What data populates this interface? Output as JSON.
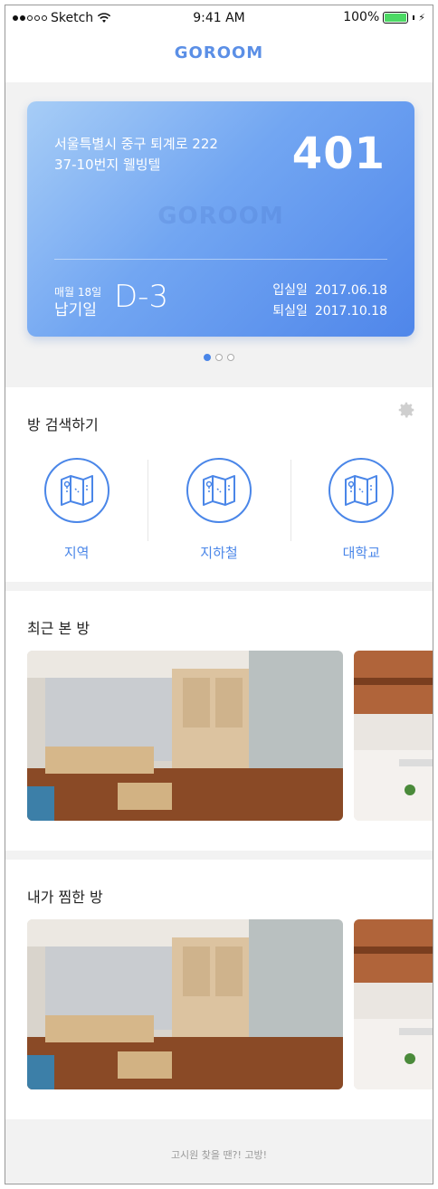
{
  "status_bar": {
    "carrier": "Sketch",
    "time": "9:41 AM",
    "battery": "100%",
    "battery_level": 1.0
  },
  "nav": {
    "title": "GOROOM"
  },
  "room_card": {
    "address_line1": "서울특별시 중구 퇴계로 222",
    "address_line2": "37-10번지 웰빙텔",
    "room_number": "401",
    "watermark": "GOROOM",
    "due_day": "매월 18일",
    "due_label": "납기일",
    "due_countdown": "D-3",
    "move_in_label": "입실일",
    "move_in_date": "2017.06.18",
    "move_out_label": "퇴실일",
    "move_out_date": "2017.10.18",
    "pager_count": 3,
    "pager_active": 1
  },
  "search": {
    "title": "방 검색하기",
    "options": [
      {
        "label": "지역",
        "icon": "map-icon"
      },
      {
        "label": "지하철",
        "icon": "map-icon"
      },
      {
        "label": "대학교",
        "icon": "map-icon"
      }
    ],
    "settings_icon": "gear-icon"
  },
  "recent": {
    "title": "최근 본 방"
  },
  "liked": {
    "title": "내가 찜한 방"
  },
  "footer": {
    "text": "고시원 찾을 땐?! 고방!"
  },
  "colors": {
    "accent": "#4a86e8",
    "background": "#f2f2f2"
  }
}
